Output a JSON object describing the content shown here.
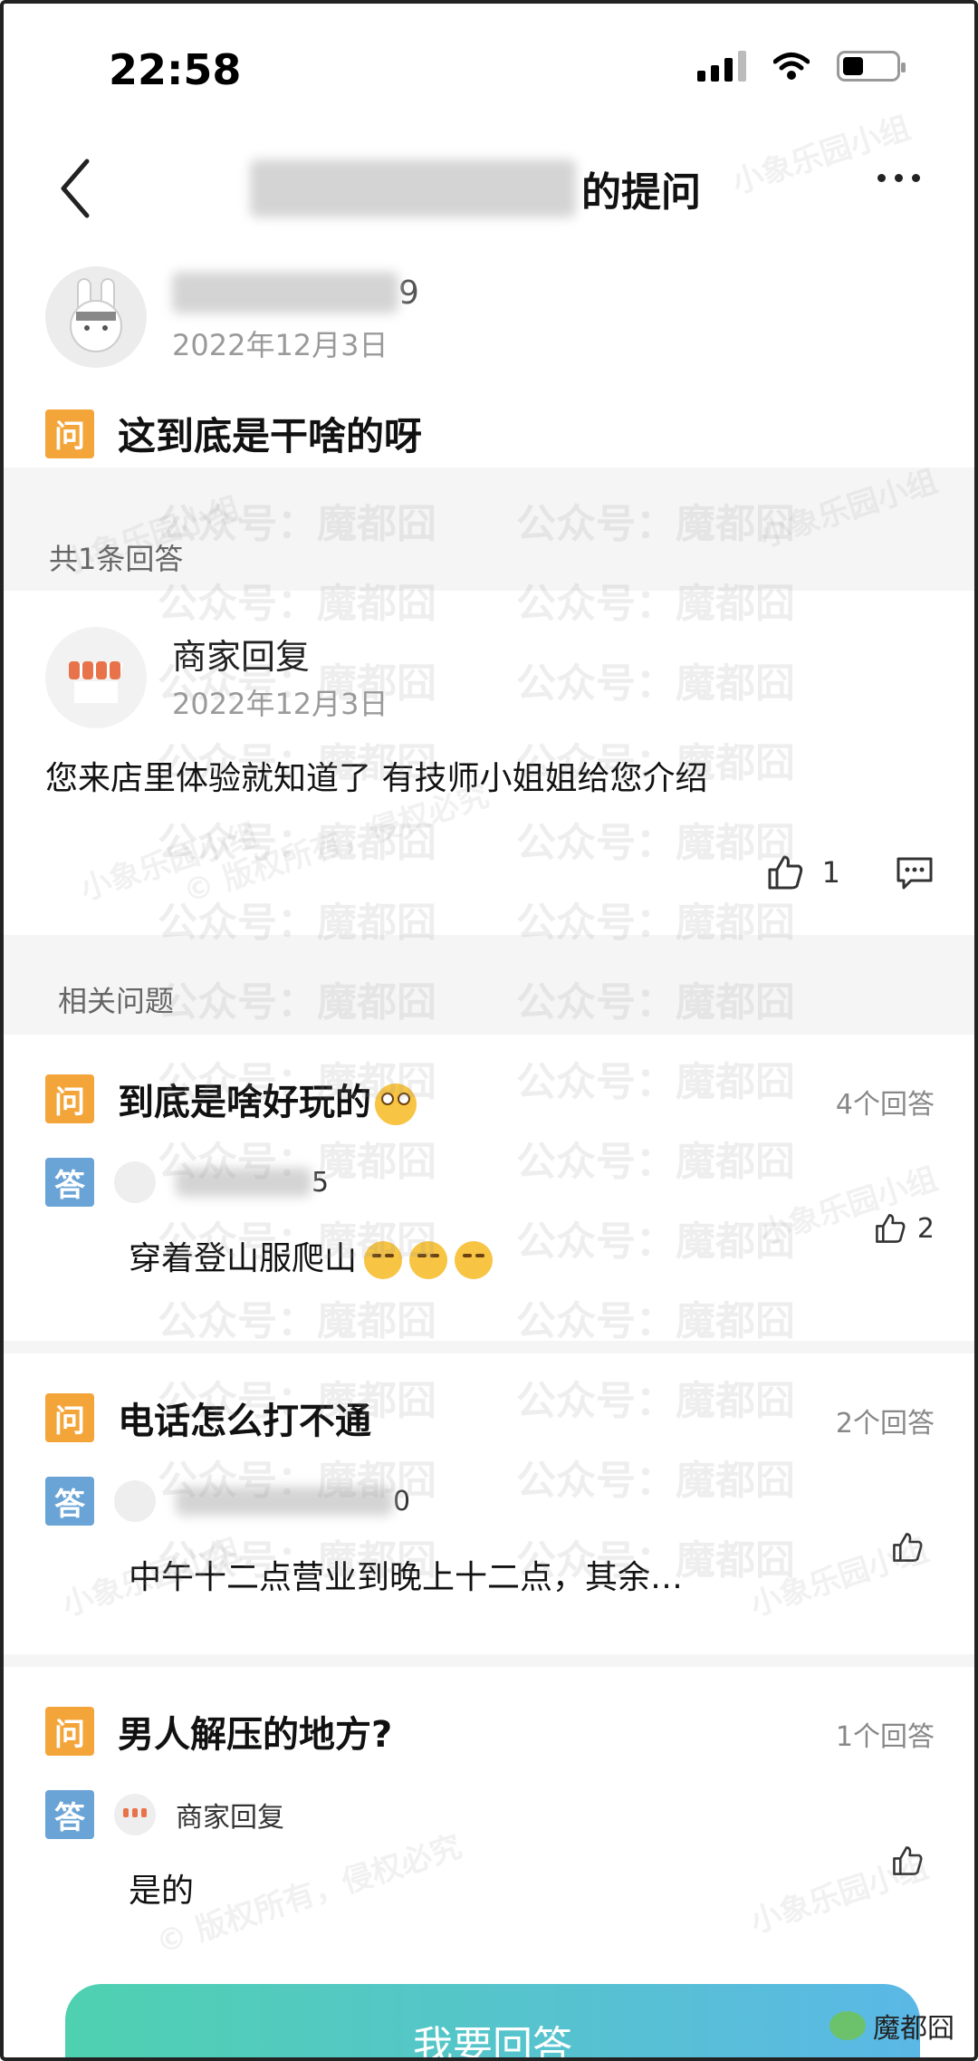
{
  "status_bar": {
    "time": "22:58"
  },
  "header": {
    "title_suffix": "的提问"
  },
  "asker": {
    "name_suffix": "9",
    "date": "2022年12月3日"
  },
  "question": {
    "badge": "问",
    "text": "这到底是干啥的呀"
  },
  "answer_count": "共1条回答",
  "answer": {
    "author": "商家回复",
    "date": "2022年12月3日",
    "text": "您来店里体验就知道了 有技师小姐姐给您介绍",
    "like_count": "1"
  },
  "related": {
    "title": "相关问题",
    "items": [
      {
        "q_badge": "问",
        "question": "到底是啥好玩的",
        "count": "4个回答",
        "a_badge": "答",
        "user_suffix": "5",
        "answer": "穿着登山服爬山",
        "likes": "2"
      },
      {
        "q_badge": "问",
        "question": "电话怎么打不通",
        "count": "2个回答",
        "a_badge": "答",
        "user_suffix": "0",
        "answer": "中午十二点营业到晚上十二点，其余…",
        "likes": ""
      },
      {
        "q_badge": "问",
        "question": "男人解压的地方?",
        "count": "1个回答",
        "a_badge": "答",
        "user_suffix": "商家回复",
        "answer": "是的",
        "likes": ""
      }
    ]
  },
  "bottom_button": "我要回答",
  "watermark_tag": "魔都囧",
  "watermarks": {
    "main": "公众号：魔都囧",
    "secondary": "小象乐园小组",
    "user_id": "用户 ID:",
    "rights": "© 版权所有，侵权必究"
  },
  "colors": {
    "question_badge": "#f4a53a",
    "answer_badge": "#6aa4d6",
    "button_gradient_start": "#4fd1b0",
    "button_gradient_end": "#5bb8e6"
  }
}
